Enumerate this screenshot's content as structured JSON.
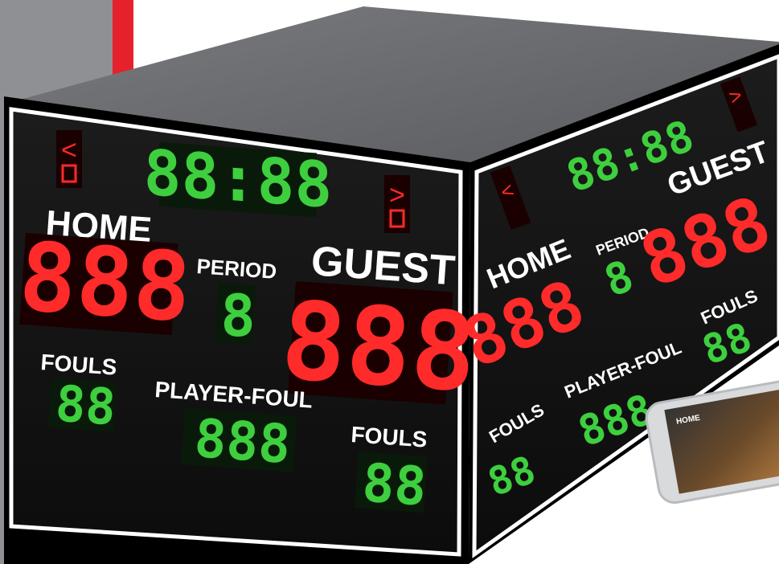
{
  "colors": {
    "accent_red": "#e5212b",
    "panel_gray": "#8f9093",
    "board_black": "#111111",
    "digit_red": "#ff2a2a",
    "digit_green": "#3ecf3e"
  },
  "front": {
    "clock": "88:88",
    "home_label": "HOME",
    "home_score": "888",
    "period_label": "PERIOD",
    "period": "8",
    "guest_label": "GUEST",
    "guest_score": "888",
    "home_fouls_label": "FOULS",
    "home_fouls": "88",
    "player_foul_label": "PLAYER-FOUL",
    "player_foul": "888",
    "guest_fouls_label": "FOULS",
    "guest_fouls": "88",
    "left_possession": "<",
    "right_possession": ">"
  },
  "side": {
    "clock": "88:88",
    "home_label": "HOME",
    "home_score": "888",
    "period_label": "PERIOD",
    "period": "8",
    "guest_label": "GUEST",
    "guest_score": "888",
    "home_fouls_label": "FOULS",
    "home_fouls": "88",
    "player_foul_label": "PLAYER-FOUL",
    "player_foul": "888",
    "guest_fouls_label": "FOULS",
    "guest_fouls": "88",
    "left_possession": "<",
    "right_possession": ">"
  },
  "phone": {
    "home_label": "HOME"
  }
}
